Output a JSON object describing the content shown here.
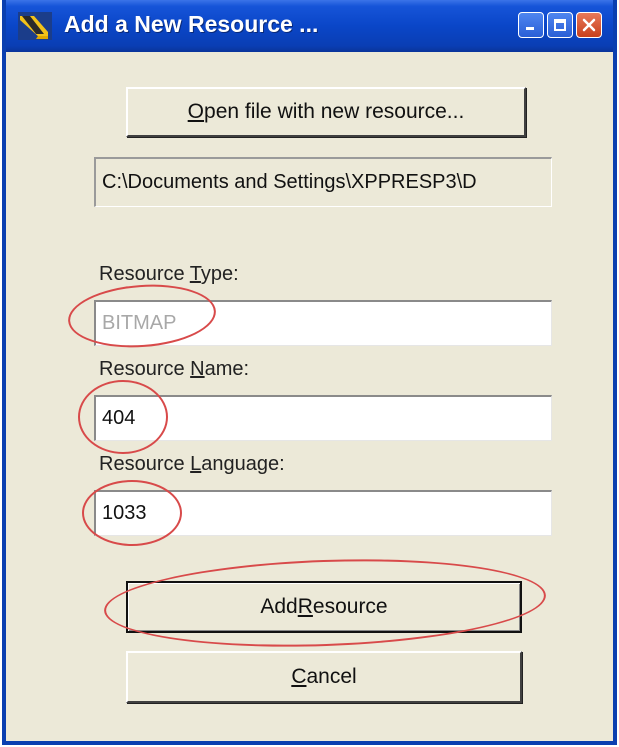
{
  "window": {
    "title": "Add a New Resource ...",
    "title_color": "#ffffff",
    "titlebar_color": "#0a46c8",
    "face_color": "#ece9d8"
  },
  "buttons": {
    "open_file": {
      "pre": "",
      "accel": "O",
      "post": "pen file with new resource..."
    },
    "add_resource": {
      "pre": "Add ",
      "accel": "R",
      "post": "esource"
    },
    "cancel": {
      "pre": "",
      "accel": "C",
      "post": "ancel"
    }
  },
  "path_display": "C:\\Documents and Settings\\XPPRESP3\\D",
  "fields": {
    "type": {
      "label_pre": "Resource ",
      "label_accel": "T",
      "label_post": "ype:",
      "value": "BITMAP",
      "disabled": true
    },
    "name": {
      "label_pre": "Resource ",
      "label_accel": "N",
      "label_post": "ame:",
      "value": "404"
    },
    "language": {
      "label_pre": "Resource ",
      "label_accel": "L",
      "label_post": "anguage:",
      "value": "1033"
    }
  },
  "annotation_color": "#d84a4a",
  "icons": [
    "app-icon",
    "minimize-icon",
    "maximize-icon",
    "close-icon"
  ]
}
